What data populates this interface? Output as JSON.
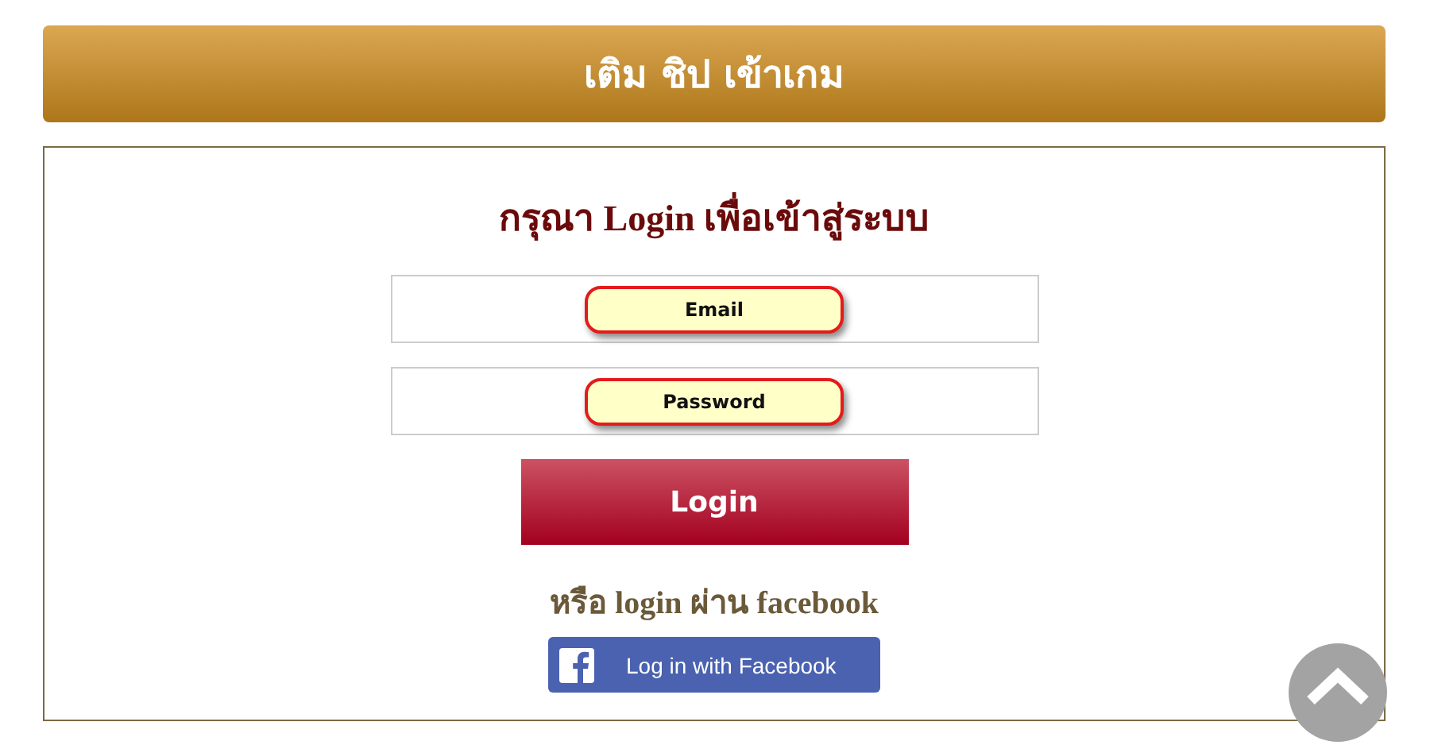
{
  "header": {
    "title": "เติม ชิป เข้าเกม"
  },
  "login": {
    "heading": "กรุณา Login เพื่อเข้าสู่ระบบ",
    "fields": [
      {
        "placeholder": "Email"
      },
      {
        "placeholder": "Password"
      }
    ],
    "submit": "Login",
    "alt_text": "หรือ login ผ่าน facebook",
    "facebook_button": "Log in with Facebook"
  }
}
